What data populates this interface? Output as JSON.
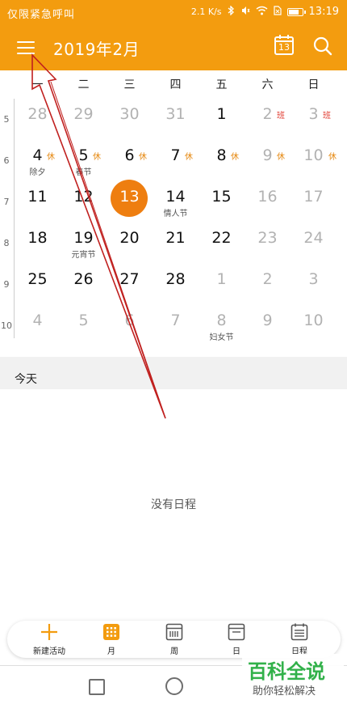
{
  "status_bar": {
    "carrier_text": "仅限紧急呼叫",
    "network_speed": "2.1 K/s",
    "time": "13:19",
    "icons": [
      "bluetooth-icon",
      "mute-icon",
      "wifi-icon",
      "no-sim-icon",
      "battery-icon"
    ],
    "battery_level": 0.85
  },
  "header": {
    "title": "2019年2月",
    "today_number": "13",
    "menu_icon": "hamburger-menu-icon",
    "search_icon": "search-icon",
    "background": "#f39c0f"
  },
  "weekdays": [
    "一",
    "二",
    "三",
    "四",
    "五",
    "六",
    "日"
  ],
  "week_numbers": [
    "5",
    "6",
    "7",
    "8",
    "9",
    "10"
  ],
  "weeks": [
    [
      {
        "num": "28",
        "dim": true
      },
      {
        "num": "29",
        "dim": true
      },
      {
        "num": "30",
        "dim": true
      },
      {
        "num": "31",
        "dim": true
      },
      {
        "num": "1"
      },
      {
        "num": "2",
        "dim": true,
        "tag": "班"
      },
      {
        "num": "3",
        "dim": true,
        "tag": "班"
      }
    ],
    [
      {
        "num": "4",
        "tag": "休",
        "note": "除夕"
      },
      {
        "num": "5",
        "tag": "休",
        "note": "春节"
      },
      {
        "num": "6",
        "tag": "休"
      },
      {
        "num": "7",
        "tag": "休"
      },
      {
        "num": "8",
        "tag": "休"
      },
      {
        "num": "9",
        "dim": true,
        "tag": "休"
      },
      {
        "num": "10",
        "dim": true,
        "tag": "休"
      }
    ],
    [
      {
        "num": "11"
      },
      {
        "num": "12"
      },
      {
        "num": "13",
        "today": true
      },
      {
        "num": "14",
        "note": "情人节"
      },
      {
        "num": "15"
      },
      {
        "num": "16",
        "dim": true
      },
      {
        "num": "17",
        "dim": true
      }
    ],
    [
      {
        "num": "18"
      },
      {
        "num": "19",
        "note": "元宵节"
      },
      {
        "num": "20"
      },
      {
        "num": "21"
      },
      {
        "num": "22"
      },
      {
        "num": "23",
        "dim": true
      },
      {
        "num": "24",
        "dim": true
      }
    ],
    [
      {
        "num": "25"
      },
      {
        "num": "26"
      },
      {
        "num": "27"
      },
      {
        "num": "28"
      },
      {
        "num": "1",
        "dim": true
      },
      {
        "num": "2",
        "dim": true
      },
      {
        "num": "3",
        "dim": true
      }
    ],
    [
      {
        "num": "4",
        "dim": true
      },
      {
        "num": "5",
        "dim": true
      },
      {
        "num": "6",
        "dim": true
      },
      {
        "num": "7",
        "dim": true
      },
      {
        "num": "8",
        "dim": true,
        "note": "妇女节"
      },
      {
        "num": "9",
        "dim": true
      },
      {
        "num": "10",
        "dim": true
      }
    ]
  ],
  "agenda": {
    "section_label": "今天",
    "empty_text": "没有日程"
  },
  "tab_bar": {
    "tabs": [
      {
        "label": "新建活动",
        "icon": "plus-icon"
      },
      {
        "label": "月",
        "icon": "month-grid-icon",
        "active": true
      },
      {
        "label": "周",
        "icon": "week-icon"
      },
      {
        "label": "日",
        "icon": "day-icon"
      },
      {
        "label": "日程",
        "icon": "agenda-icon"
      }
    ],
    "accent": "#f39c0f"
  },
  "nav_bar": {
    "icons": [
      "recent-apps-icon",
      "home-icon"
    ]
  },
  "watermark": {
    "title": "百科全说",
    "subtitle": "助你轻松解决"
  },
  "annotation": {
    "arrow_color": "#c0201f",
    "arrow_target": "hamburger-menu-icon"
  }
}
